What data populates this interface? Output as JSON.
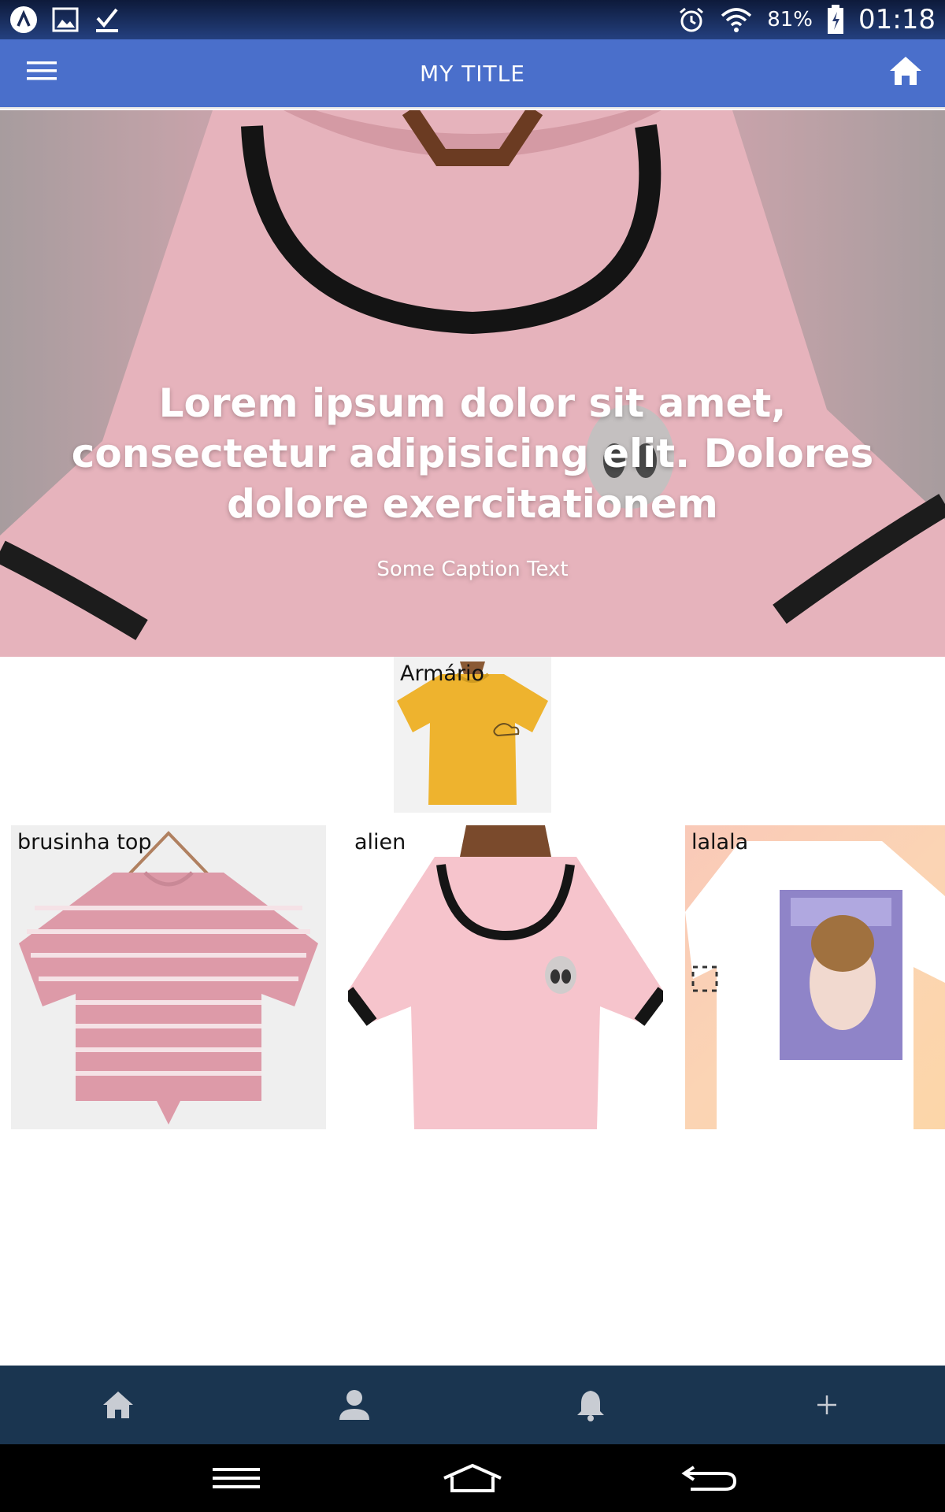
{
  "status_bar": {
    "left_icons": [
      "app-icon",
      "image-icon",
      "download-done-icon"
    ],
    "right_icons": [
      "alarm-icon",
      "wifi-icon",
      "battery-charging-icon"
    ],
    "battery": "81%",
    "time": "01:18"
  },
  "app_bar": {
    "title": "MY TITLE",
    "left_icon": "menu-icon",
    "right_icon": "home-icon"
  },
  "hero": {
    "heading": "Lorem ipsum dolor sit amet, consectetur adipisicing elit. Dolores dolore exercitationem",
    "caption": "Some Caption Text"
  },
  "featured": {
    "label": "Armário"
  },
  "products": [
    {
      "label": "brusinha top"
    },
    {
      "label": "alien"
    },
    {
      "label": "lalala"
    }
  ],
  "bottom_nav": {
    "items": [
      "home-icon",
      "person-icon",
      "bell-icon",
      "plus-icon"
    ]
  },
  "system_nav": {
    "items": [
      "recents-icon",
      "home-outline-icon",
      "back-icon"
    ]
  },
  "colors": {
    "app_bar": "#4a6fcb",
    "bottom_nav": "#1a3550",
    "system_nav": "#000000"
  }
}
